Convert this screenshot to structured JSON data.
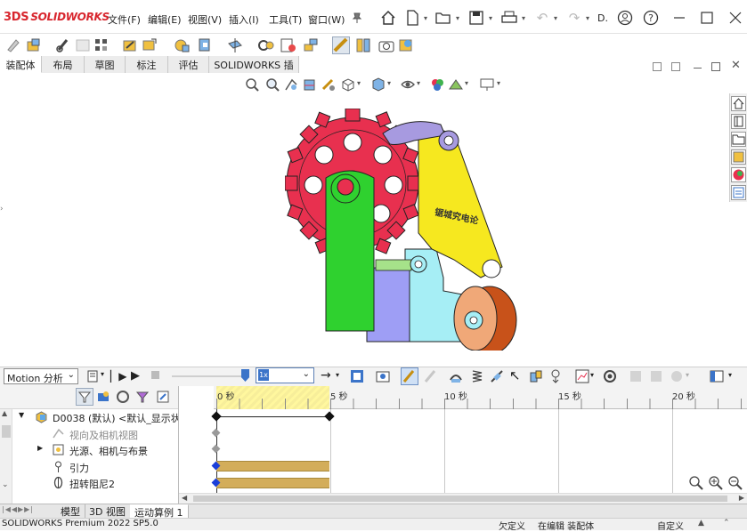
{
  "app": {
    "logo_prefix": "3DS",
    "logo": "SOLIDWORKS",
    "menus": [
      "文件(F)",
      "编辑(E)",
      "视图(V)",
      "插入(I)",
      "工具(T)",
      "窗口(W)"
    ],
    "truncated_label": "D."
  },
  "command_tabs": [
    "装配体",
    "布局",
    "草图",
    "标注",
    "评估",
    "SOLIDWORKS 插件"
  ],
  "graphics": {
    "model_text": "锯城究电论",
    "colors": {
      "gear": "#e8304f",
      "arm": "#f6e81f",
      "post": "#2fd12f",
      "block": "#9e9ef5",
      "bracket": "#a6eef5",
      "wheel": "#c8521a",
      "link": "#a79ae0"
    }
  },
  "motion": {
    "study_type": "Motion 分析",
    "speed": "1x"
  },
  "tree": {
    "items": [
      {
        "label": "D0038 (默认) <默认_显示状态",
        "indent": 0,
        "icon": "assembly-icon"
      },
      {
        "label": "视向及相机视图",
        "indent": 1,
        "icon": "camera-icon",
        "dim": true
      },
      {
        "label": "光源、相机与布景",
        "indent": 1,
        "icon": "lights-icon"
      },
      {
        "label": "引力",
        "indent": 1,
        "icon": "gravity-icon"
      },
      {
        "label": "扭转阻尼2",
        "indent": 1,
        "icon": "damper-icon"
      }
    ]
  },
  "timeline": {
    "ticks": [
      "0 秒",
      "5 秒",
      "10 秒",
      "15 秒",
      "20 秒"
    ]
  },
  "bottom_tabs": [
    "模型",
    "3D 视图",
    "运动算例 1"
  ],
  "status": {
    "version": "SOLIDWORKS Premium 2022 SP5.0",
    "definition": "欠定义",
    "editing": "在编辑 装配体",
    "units": "自定义"
  }
}
